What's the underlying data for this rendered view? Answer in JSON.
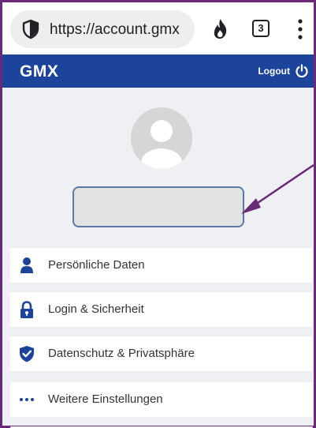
{
  "browser": {
    "url": "https://account.gmx",
    "tab_count": "3",
    "icons": [
      "shield-icon",
      "fire-icon",
      "tabs-icon",
      "menu-icon"
    ]
  },
  "header": {
    "logo": "GMX",
    "logout_label": "Logout",
    "background_color": "#1c449b"
  },
  "profile": {
    "avatar_icon": "user-avatar-icon"
  },
  "menu": {
    "items": [
      {
        "label": "Persönliche Daten",
        "icon": "person-icon"
      },
      {
        "label": "Login & Sicherheit",
        "icon": "lock-icon"
      },
      {
        "label": "Datenschutz & Privatsphäre",
        "icon": "shield-check-icon"
      },
      {
        "label": "Weitere Einstellungen",
        "icon": "more-dots-icon"
      }
    ]
  },
  "colors": {
    "accent": "#1c449b",
    "frame": "#6b2a78",
    "annotation_arrow": "#6b2a78"
  }
}
